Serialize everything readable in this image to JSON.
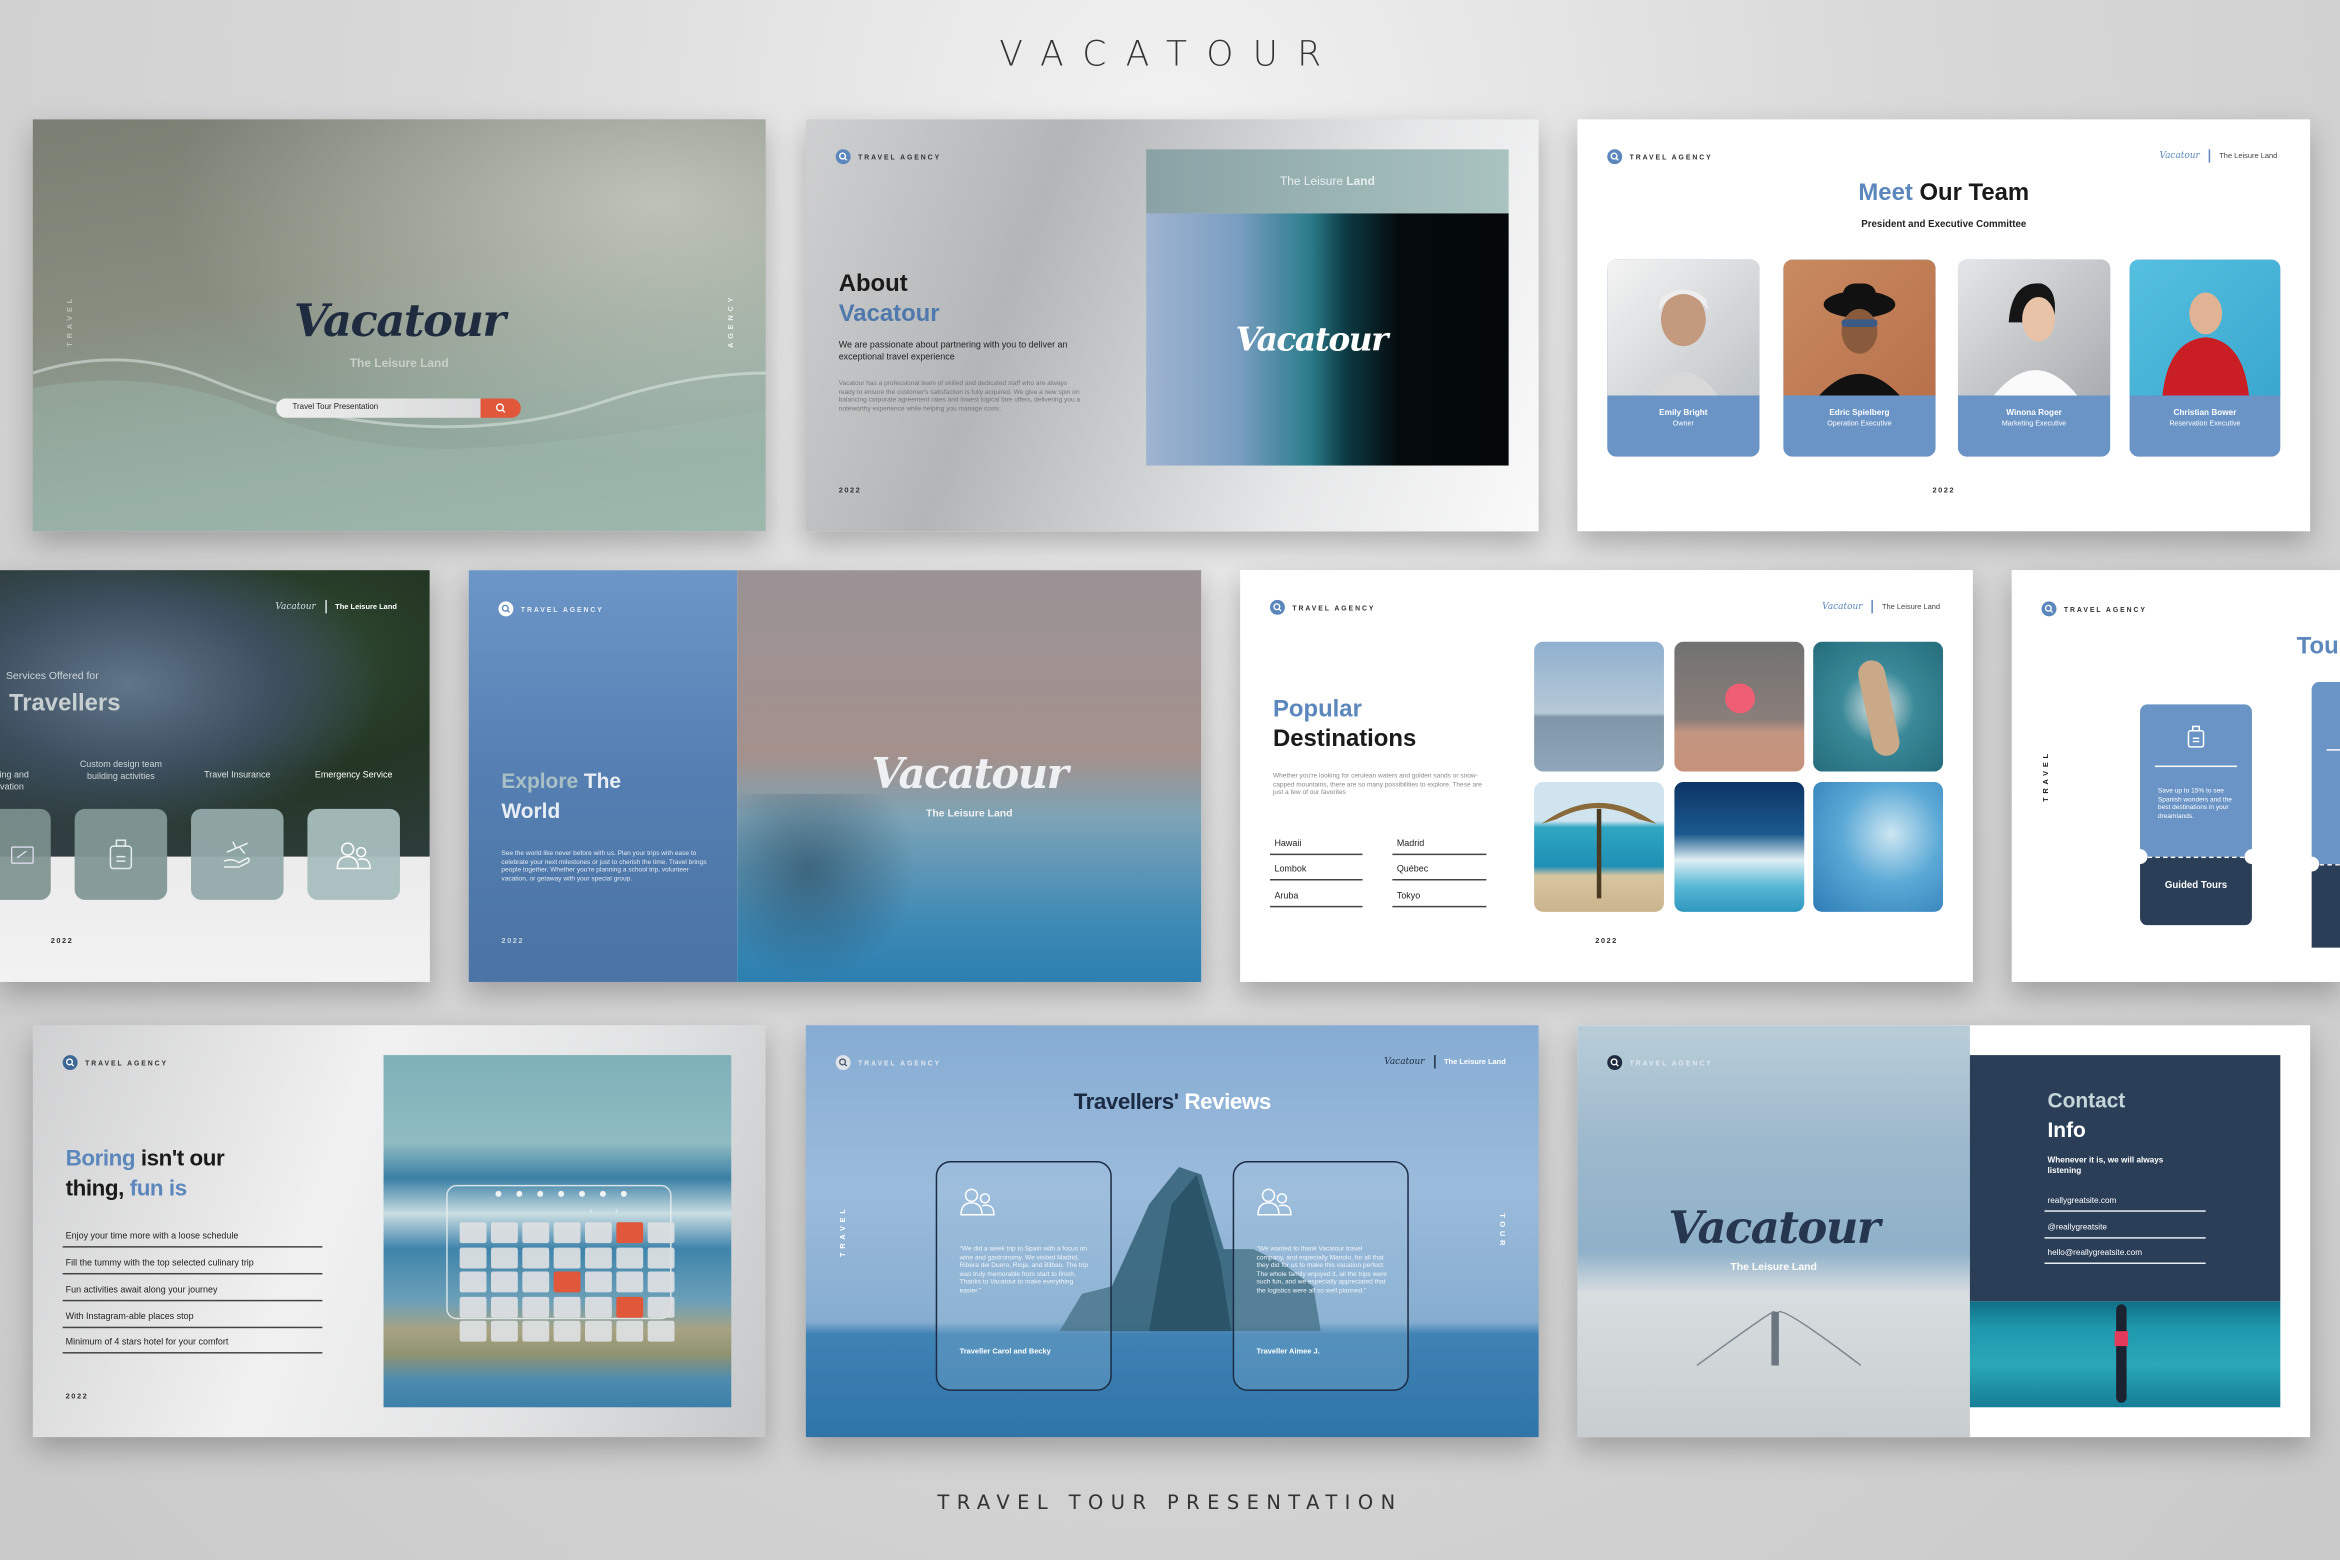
{
  "header": {
    "title": "VACATOUR"
  },
  "footer": {
    "subtitle": "TRAVEL TOUR PRESENTATION"
  },
  "common": {
    "agency": "TRAVEL AGENCY",
    "brand": "Vacatour",
    "tagline": "The Leisure Land",
    "year": "2022",
    "logo_icon": "search-icon"
  },
  "colors": {
    "accent_blue": "#5b87bd",
    "navy": "#2b3e58",
    "orange": "#e0573a",
    "sage": "#8fa8a6"
  },
  "slides": {
    "cover": {
      "side_left": "TRAVEL",
      "side_right": "AGENCY",
      "search_value": "Travel Tour Presentation",
      "search_icon": "search-icon"
    },
    "about": {
      "heading": "About",
      "heading_accent": "Vacatour",
      "band_light": "The Leisure",
      "band_bold": "Land",
      "lead": "We are passionate about partnering with you to deliver an exceptional travel experience",
      "body": "Vacatour has a professional team of skilled and dedicated staff who are always ready to ensure the customer's satisfaction is fully acquired. We give a new spin on balancing corporate agreement rates and lowest logical fare offers, delivering you a noteworthy experience while helping you manage costs."
    },
    "team": {
      "title_accent": "Meet",
      "title_rest": "Our Team",
      "subtitle": "President and Executive Committee",
      "members": [
        {
          "name": "Emily Bright",
          "role": "Owner"
        },
        {
          "name": "Edric Spielberg",
          "role": "Operation Executive"
        },
        {
          "name": "Winona Roger",
          "role": "Marketing Executive"
        },
        {
          "name": "Christian Bower",
          "role": "Reservation Executive"
        }
      ]
    },
    "services": {
      "eyebrow": "Services Offered for",
      "title": "Travellers",
      "items": [
        {
          "label": "ting and\nrvation",
          "icon": "ticket-icon"
        },
        {
          "label": "Custom design team building activities",
          "icon": "luggage-icon"
        },
        {
          "label": "Travel Insurance",
          "icon": "plane-hand-icon"
        },
        {
          "label": "Emergency Service",
          "icon": "users-icon"
        }
      ]
    },
    "explore": {
      "title_accent": "Explore",
      "title_rest": "The",
      "title_line2": "World",
      "body": "See the world like never before with us. Plan your trips with ease to celebrate your next milestones or just to cherish the time. Travel brings people together. Whether you're planning a school trip, volunteer vacation, or getaway with your special group."
    },
    "destinations": {
      "title_accent": "Popular",
      "title_rest": "Destinations",
      "body": "Whether you're looking for cerulean waters and golden sands or snow-capped mountains, there are so many possibilities to explore. These are just a few of our favorites",
      "places": [
        "Hawaii",
        "Madrid",
        "Lombok",
        "Québec",
        "Aruba",
        "Tokyo"
      ]
    },
    "tours": {
      "side": "TRAVEL",
      "title_partial": "Tou",
      "ticket_text": "Save up to 15% to see Spanish wonders and the best destinations in your dreamlands.",
      "ticket_label": "Guided Tours",
      "ticket_icon": "luggage-icon"
    },
    "schedule": {
      "title_accent": "Boring",
      "title_rest": "isn't our",
      "title_line2": "thing,",
      "title_line2_accent": "fun is",
      "items": [
        "Enjoy your time more with a loose schedule",
        "Fill the tummy with the top selected culinary trip",
        "Fun activities await along your journey",
        "With Instagram-able places stop",
        "Minimum of 4 stars hotel for your comfort"
      ],
      "calendar_highlights": [
        [
          0,
          5
        ],
        [
          2,
          3
        ],
        [
          3,
          5
        ]
      ]
    },
    "reviews": {
      "title": "Travellers'",
      "title_accent": "Reviews",
      "side_left": "TRAVEL",
      "side_right": "TOUR",
      "items": [
        {
          "quote": "\"We did a week trip to Spain with a focus on wine and gastronomy. We visited Madrid, Ribera del Duero, Rioja, and Bilbao. The trip was truly memorable from start to finish. Thanks to Vacatour to make everything easier.\"",
          "author": "Traveller Carol and Becky"
        },
        {
          "quote": "\"We wanted to thank Vacatour travel company, and especially Manolo, for all that they did for us to make this vacation perfect. The whole family enjoyed it, all the trips were such fun, and we especially appreciated that the logistics were all so well planned.\"",
          "author": "Traveller Aimee J."
        }
      ]
    },
    "contact": {
      "title": "Contact",
      "title_line2": "Info",
      "lead": "Whenever it is, we will always listening",
      "items": [
        "reallygreatsite.com",
        "@reallygreatsite",
        "hello@reallygreatsite.com"
      ]
    }
  }
}
